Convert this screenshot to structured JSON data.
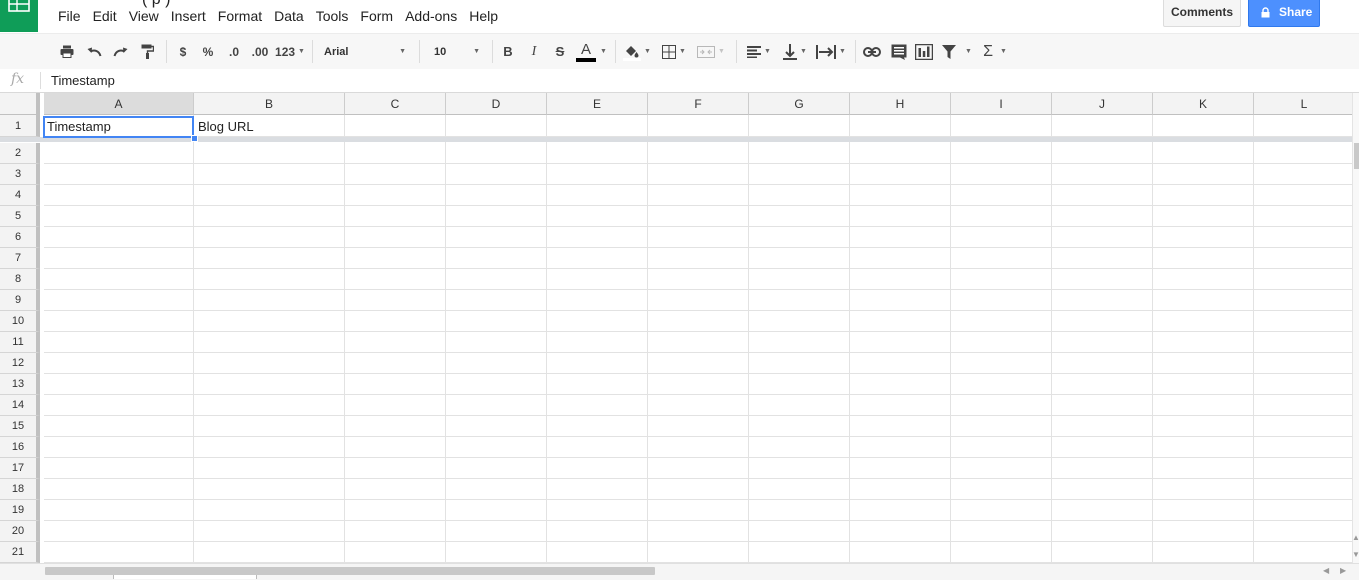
{
  "window": {
    "title_fragment": "(     p     )"
  },
  "menu": [
    "File",
    "Edit",
    "View",
    "Insert",
    "Format",
    "Data",
    "Tools",
    "Form",
    "Add-ons",
    "Help"
  ],
  "header_buttons": {
    "comments": "Comments",
    "share": "Share"
  },
  "toolbar": {
    "currency": "$",
    "percent": "%",
    "decrease_decimals": ".0",
    "increase_decimals": ".00",
    "more_formats": "123",
    "font": "Arial",
    "font_size": "10",
    "bold": "B",
    "italic": "I",
    "strikethrough": "S",
    "text_color_glyph": "A",
    "sum_glyph": "Σ",
    "colors": {
      "text_color_underline": "#000000"
    },
    "icons": [
      "print-icon",
      "undo-icon",
      "redo-icon",
      "paint-format-icon",
      "fill-color-icon",
      "borders-icon",
      "merge-cells-icon",
      "align-icon",
      "vertical-align-icon",
      "wrap-icon",
      "link-icon",
      "comment-icon",
      "chart-icon",
      "filter-icon",
      "functions-icon"
    ]
  },
  "formula_bar": {
    "fx_label": "fx",
    "value": "Timestamp"
  },
  "grid": {
    "columns": [
      "A",
      "B",
      "C",
      "D",
      "E",
      "F",
      "G",
      "H",
      "I",
      "J",
      "K",
      "L"
    ],
    "rows": [
      "1",
      "2",
      "3",
      "4",
      "5",
      "6",
      "7",
      "8",
      "9",
      "10",
      "11",
      "12",
      "13",
      "14",
      "15",
      "16",
      "17",
      "18",
      "19",
      "20",
      "21"
    ],
    "cells": {
      "A1": "Timestamp",
      "B1": "Blog URL"
    },
    "selected_cell": "A1",
    "frozen_rows": 1
  },
  "colors": {
    "brand_green": "#0f9d58",
    "share_blue": "#4d90fe",
    "selection_blue": "#4285f4"
  }
}
